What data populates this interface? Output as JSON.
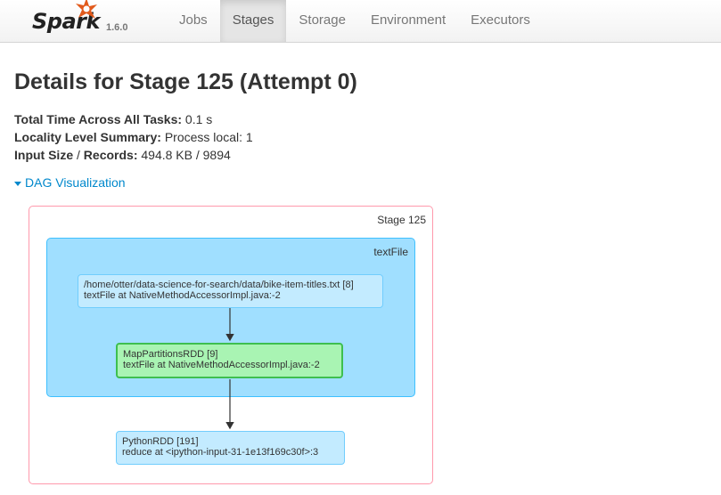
{
  "brand": {
    "name": "Spark",
    "version": "1.6.0"
  },
  "nav": {
    "tabs": [
      "Jobs",
      "Stages",
      "Storage",
      "Environment",
      "Executors"
    ],
    "active": "Stages"
  },
  "page": {
    "title": "Details for Stage 125 (Attempt 0)"
  },
  "summary": {
    "total_time_label": "Total Time Across All Tasks:",
    "total_time_value": "0.1 s",
    "locality_label": "Locality Level Summary:",
    "locality_value": "Process local: 1",
    "input_label_a": "Input Size",
    "input_sep": " / ",
    "input_label_b": "Records:",
    "input_value": "494.8 KB / 9894"
  },
  "dag": {
    "toggle_label": "DAG Visualization",
    "stage_label": "Stage 125",
    "cluster_label": "textFile",
    "nodes": [
      {
        "line1": "/home/otter/data-science-for-search/data/bike-item-titles.txt [8]",
        "line2": "textFile at NativeMethodAccessorImpl.java:-2"
      },
      {
        "line1": "MapPartitionsRDD [9]",
        "line2": "textFile at NativeMethodAccessorImpl.java:-2"
      },
      {
        "line1": "PythonRDD [191]",
        "line2": "reduce at <ipython-input-31-1e13f169c30f>:3"
      }
    ]
  },
  "colors": {
    "brand_star": "#e25a1c",
    "link": "#0088cc",
    "stage_border": "#ff99ac",
    "cluster_fill": "#a0dfff",
    "rdd_fill": "#c3ebff",
    "highlight_fill": "#a9f4b3",
    "highlight_border": "#3ebf4f"
  }
}
